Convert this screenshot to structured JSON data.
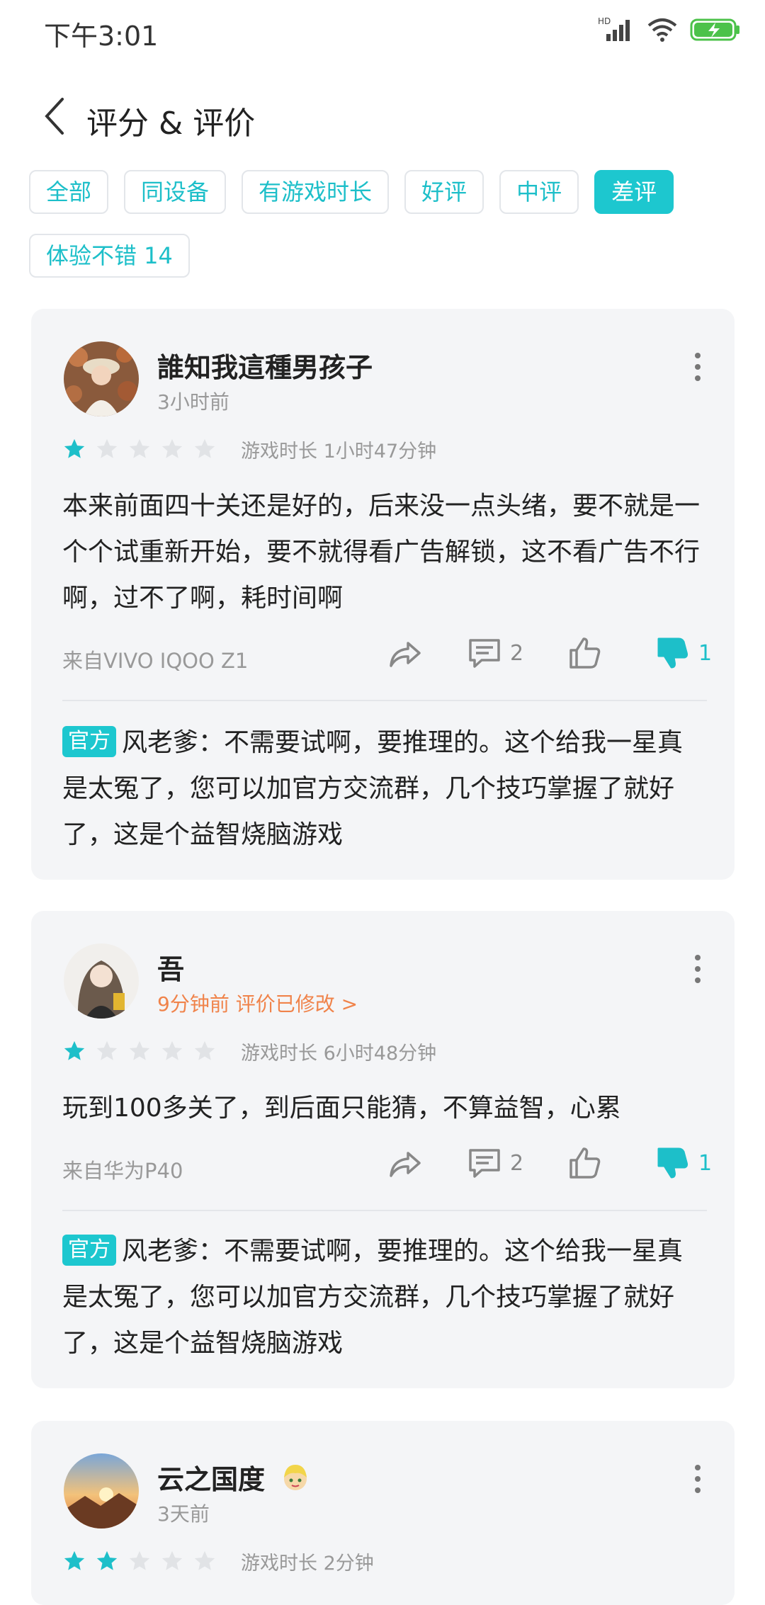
{
  "status_bar": {
    "time": "下午3:01",
    "network_label": "HD"
  },
  "header": {
    "title": "评分 & 评价"
  },
  "filters": [
    {
      "label": "全部",
      "active": false
    },
    {
      "label": "同设备",
      "active": false
    },
    {
      "label": "有游戏时长",
      "active": false
    },
    {
      "label": "好评",
      "active": false
    },
    {
      "label": "中评",
      "active": false
    },
    {
      "label": "差评",
      "active": true
    },
    {
      "label": "体验不错 14",
      "active": false
    }
  ],
  "reviews": [
    {
      "user": "誰知我這種男孩子",
      "time": "3小时前",
      "rating": 1,
      "playtime": "游戏时长 1小时47分钟",
      "text": "本来前面四十关还是好的，后来没一点头绪，要不就是一个个试重新开始，要不就得看广告解锁，这不看广告不行啊，过不了啊，耗时间啊",
      "source": "来自VIVO IQOO Z1",
      "comments": "2",
      "dislikes": "1",
      "reply_badge": "官方",
      "reply_text": "风老爹：不需要试啊，要推理的。这个给我一星真是太冤了，您可以加官方交流群，几个技巧掌握了就好了，这是个益智烧脑游戏"
    },
    {
      "user": "吾",
      "time": "9分钟前 评价已修改 >",
      "rating": 1,
      "playtime": "游戏时长 6小时48分钟",
      "text": "玩到100多关了，到后面只能猜，不算益智，心累",
      "source": "来自华为P40",
      "comments": "2",
      "dislikes": "1",
      "reply_badge": "官方",
      "reply_text": "风老爹：不需要试啊，要推理的。这个给我一星真是太冤了，您可以加官方交流群，几个技巧掌握了就好了，这是个益智烧脑游戏"
    },
    {
      "user": "云之国度",
      "time": "3天前",
      "rating": 2,
      "playtime": "游戏时长 2分钟"
    }
  ],
  "colors": {
    "accent": "#1dc7cf",
    "star_active": "#1dbfc9",
    "star_inactive": "#e1e3e6",
    "edited": "#f0834a"
  },
  "icons": [
    "back-icon",
    "more-icon",
    "share-icon",
    "comment-icon",
    "thumb-up-icon",
    "thumb-down-icon",
    "star-icon"
  ]
}
